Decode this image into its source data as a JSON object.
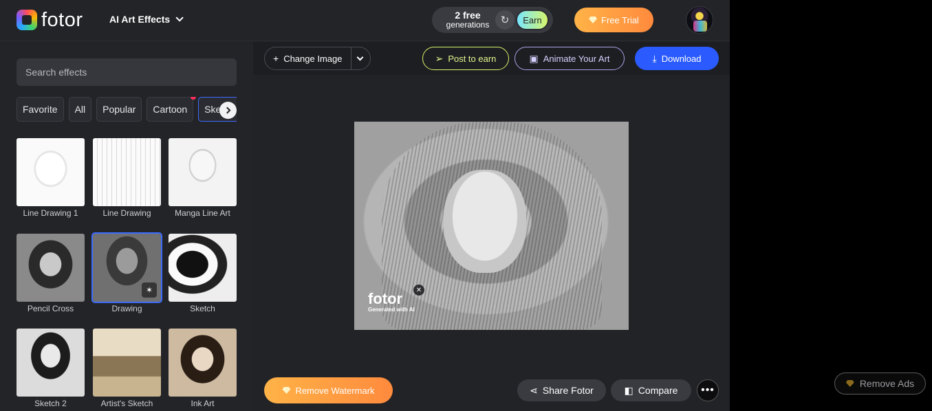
{
  "header": {
    "brand": "fotor",
    "menu_label": "AI Art Effects",
    "generations_count": "2 free",
    "generations_label": "generations",
    "earn_label": "Earn",
    "trial_label": "Free Trial"
  },
  "sidebar": {
    "search_placeholder": "Search effects",
    "chips": [
      {
        "label": "Favorite"
      },
      {
        "label": "All"
      },
      {
        "label": "Popular"
      },
      {
        "label": "Cartoon"
      },
      {
        "label": "Sketch"
      }
    ],
    "effects": [
      {
        "label": "Line Drawing 1"
      },
      {
        "label": "Line Drawing"
      },
      {
        "label": "Manga Line Art"
      },
      {
        "label": "Pencil Cross"
      },
      {
        "label": "Drawing"
      },
      {
        "label": "Sketch"
      },
      {
        "label": "Sketch 2"
      },
      {
        "label": "Artist's Sketch"
      },
      {
        "label": "Ink Art"
      }
    ]
  },
  "toolbar": {
    "change_image": "Change Image",
    "post_to_earn": "Post to earn",
    "animate": "Animate Your Art",
    "download": "Download"
  },
  "canvas": {
    "watermark_brand": "fotor",
    "watermark_sub": "Generated with AI"
  },
  "actions": {
    "remove_watermark": "Remove Watermark",
    "share": "Share Fotor",
    "compare": "Compare"
  },
  "ads": {
    "remove_ads": "Remove Ads"
  },
  "colors": {
    "accent": "#2b5bff",
    "selected_outline": "#3c6cff",
    "trial_gradient_start": "#ffb347",
    "trial_gradient_end": "#ff8a3d"
  }
}
